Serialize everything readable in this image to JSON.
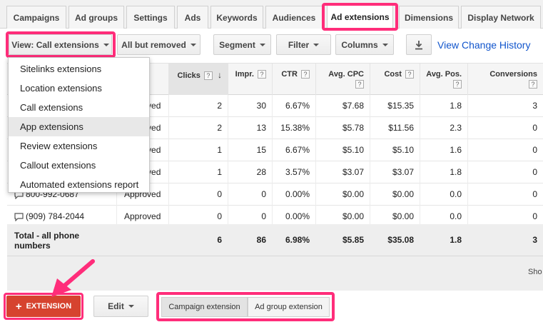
{
  "tabs": [
    "Campaigns",
    "Ad groups",
    "Settings",
    "Ads",
    "Keywords",
    "Audiences",
    "Ad extensions",
    "Dimensions",
    "Display Network"
  ],
  "active_tab": "Ad extensions",
  "toolbar": {
    "view_label": "View: Call extensions",
    "status_filter_label": "All but removed",
    "segment_label": "Segment",
    "filter_label": "Filter",
    "columns_label": "Columns",
    "change_history_link": "View Change History"
  },
  "view_menu": {
    "items": [
      "Sitelinks extensions",
      "Location extensions",
      "Call extensions",
      "App extensions",
      "Review extensions",
      "Callout extensions",
      "Automated extensions report"
    ],
    "hovered": "App extensions"
  },
  "table": {
    "columns": [
      "Clicks",
      "Impr.",
      "CTR",
      "Avg. CPC",
      "Cost",
      "Avg. Pos.",
      "Conversions"
    ],
    "help_glyph": "?",
    "sort_glyph": "↓",
    "rows": [
      {
        "phone": "",
        "status": "Approved",
        "clicks": "2",
        "impr": "30",
        "ctr": "6.67%",
        "cpc": "$7.68",
        "cost": "$15.35",
        "pos": "1.8",
        "conv": "3"
      },
      {
        "phone": "",
        "status": "Approved",
        "clicks": "2",
        "impr": "13",
        "ctr": "15.38%",
        "cpc": "$5.78",
        "cost": "$11.56",
        "pos": "2.3",
        "conv": "0"
      },
      {
        "phone": "",
        "status": "Approved",
        "clicks": "1",
        "impr": "15",
        "ctr": "6.67%",
        "cpc": "$5.10",
        "cost": "$5.10",
        "pos": "1.6",
        "conv": "0"
      },
      {
        "phone": "",
        "status": "Approved",
        "clicks": "1",
        "impr": "28",
        "ctr": "3.57%",
        "cpc": "$3.07",
        "cost": "$3.07",
        "pos": "1.8",
        "conv": "0"
      },
      {
        "phone": "800-992-0687",
        "status": "Approved",
        "clicks": "0",
        "impr": "0",
        "ctr": "0.00%",
        "cpc": "$0.00",
        "cost": "$0.00",
        "pos": "0.0",
        "conv": "0"
      },
      {
        "phone": "(909) 784-2044",
        "status": "Approved",
        "clicks": "0",
        "impr": "0",
        "ctr": "0.00%",
        "cpc": "$0.00",
        "cost": "$0.00",
        "pos": "0.0",
        "conv": "0"
      }
    ],
    "total": {
      "label_line1": "Total - all phone",
      "label_line2": "numbers",
      "clicks": "6",
      "impr": "86",
      "ctr": "6.98%",
      "cpc": "$5.85",
      "cost": "$35.08",
      "pos": "1.8",
      "conv": "3"
    },
    "show_text": "Sho"
  },
  "bottom": {
    "extension_button": "EXTENSION",
    "edit_button": "Edit",
    "campaign_extension": "Campaign extension",
    "ad_group_extension": "Ad group extension"
  },
  "colors": {
    "highlight": "#ff2d7a",
    "accent_red": "#d6432f",
    "link": "#1155cc"
  }
}
